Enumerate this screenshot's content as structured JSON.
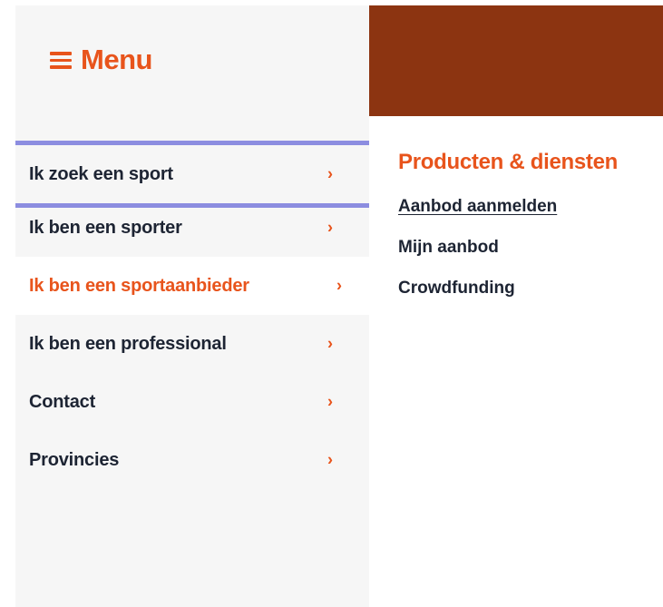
{
  "menu": {
    "label": "Menu",
    "icon": "hamburger-icon"
  },
  "nav": {
    "items": [
      {
        "label": "Ik zoek een sport",
        "chevron": "›",
        "state": "focused"
      },
      {
        "label": "Ik ben een sporter",
        "chevron": "›",
        "state": "default"
      },
      {
        "label": "Ik ben een sportaanbieder",
        "chevron": "›",
        "state": "active"
      },
      {
        "label": "Ik ben een professional",
        "chevron": "›",
        "state": "default"
      },
      {
        "label": "Contact",
        "chevron": "›",
        "state": "default"
      },
      {
        "label": "Provincies",
        "chevron": "›",
        "state": "default"
      }
    ]
  },
  "panel": {
    "title": "Producten & diensten",
    "links": [
      {
        "label": "Aanbod aanmelden",
        "underlined": true
      },
      {
        "label": "Mijn aanbod",
        "underlined": false
      },
      {
        "label": "Crowdfunding",
        "underlined": false
      }
    ]
  },
  "colors": {
    "accent": "#e8541c",
    "banner": "#8c3411",
    "focus_outline": "#8c8de0",
    "sidebar_bg": "#f6f6f6",
    "text_dark": "#1d2433"
  }
}
